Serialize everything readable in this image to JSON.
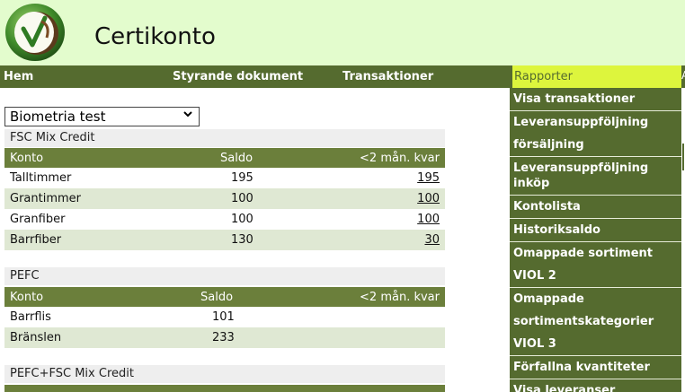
{
  "app": {
    "title": "Certikonto"
  },
  "nav": {
    "items": [
      "Hem",
      "Styrande dokument",
      "Transaktioner"
    ],
    "active": "Rapporter",
    "edge": "A"
  },
  "company_select": {
    "value": "Biometria test"
  },
  "sections": [
    {
      "title": "FSC Mix Credit",
      "headers": [
        "Konto",
        "Saldo",
        "<2 mån. kvar"
      ],
      "rows": [
        [
          "Talltimmer",
          "195",
          "195"
        ],
        [
          "Grantimmer",
          "100",
          "100"
        ],
        [
          "Granfiber",
          "100",
          "100"
        ],
        [
          "Barrfiber",
          "130",
          "30"
        ]
      ]
    },
    {
      "title": "PEFC",
      "headers": [
        "Konto",
        "Saldo",
        "<2 mån. kvar"
      ],
      "rows": [
        [
          "Barrflis",
          "101"
        ],
        [
          "Bränslen",
          "233"
        ]
      ]
    },
    {
      "title": "PEFC+FSC Mix Credit"
    }
  ],
  "report_menu": [
    "Visa transaktioner",
    "Leveransuppföljning försäljning",
    "Leveransuppföljning inköp",
    "Kontolista",
    "Historiksaldo",
    "Omappade sortiment VIOL 2",
    "Omappade sortimentskategorier VIOL 3",
    "Förfallna kvantiteter",
    "Visa leveranser"
  ],
  "colors": {
    "header_bg": "#e3fccd",
    "nav_bg": "#556b2f",
    "active_bg": "#ddf53d",
    "row_alt": "#dfe8d3"
  }
}
